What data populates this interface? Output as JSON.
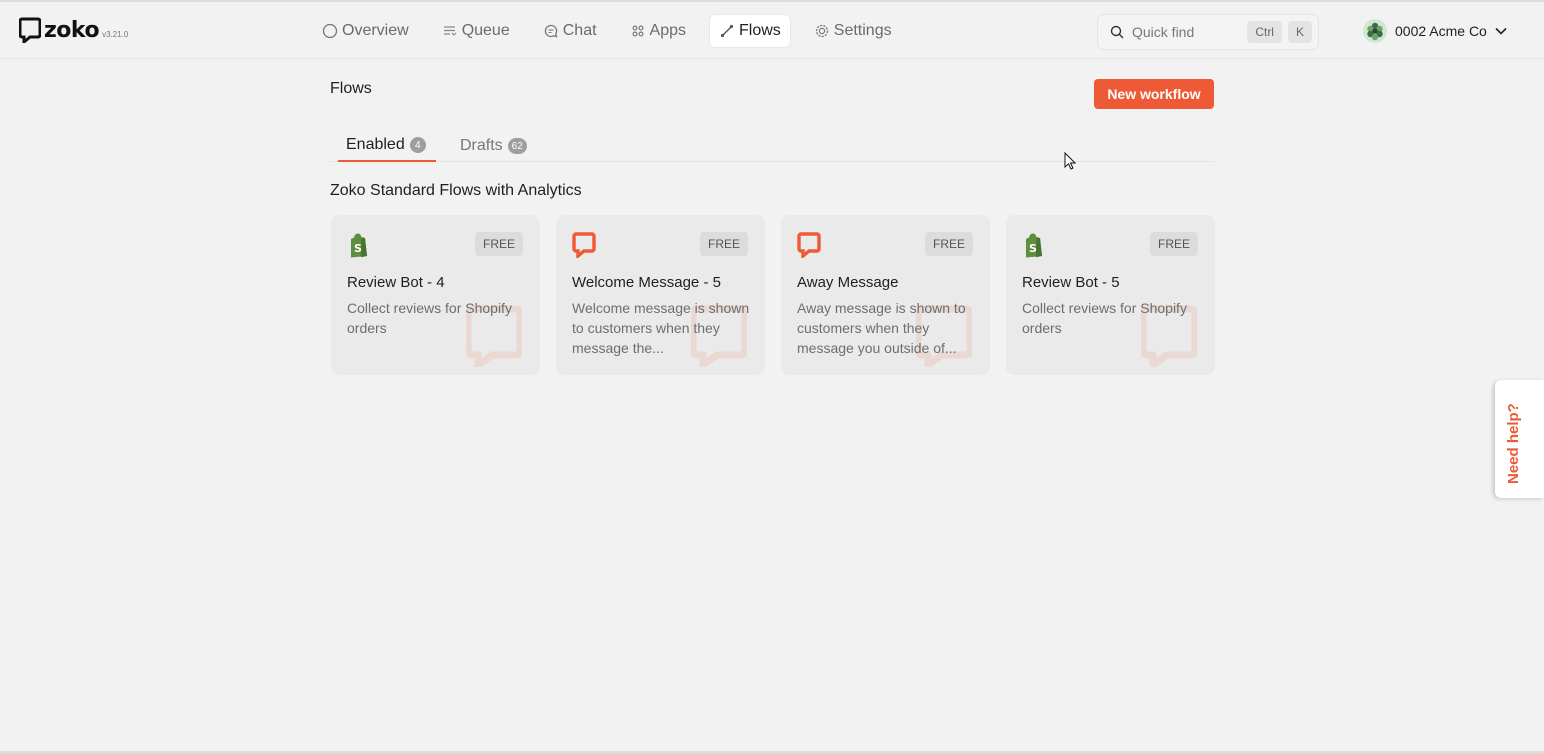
{
  "app": {
    "name": "zoko",
    "version": "v3.21.0"
  },
  "nav": [
    {
      "label": "Overview",
      "icon": "circle-icon",
      "active": false
    },
    {
      "label": "Queue",
      "icon": "queue-icon",
      "active": false
    },
    {
      "label": "Chat",
      "icon": "chat-icon",
      "active": false
    },
    {
      "label": "Apps",
      "icon": "apps-grid-icon",
      "active": false
    },
    {
      "label": "Flows",
      "icon": "flows-icon",
      "active": true
    },
    {
      "label": "Settings",
      "icon": "gear-icon",
      "active": false
    }
  ],
  "search": {
    "placeholder": "Quick find",
    "shortcut_mod": "Ctrl",
    "shortcut_key": "K"
  },
  "account": {
    "name": "0002 Acme Co"
  },
  "page": {
    "title": "Flows",
    "new_button": "New workflow"
  },
  "tabs": [
    {
      "label": "Enabled",
      "count": "4",
      "active": true
    },
    {
      "label": "Drafts",
      "count": "62",
      "active": false
    }
  ],
  "section": {
    "title": "Zoko Standard Flows with Analytics"
  },
  "cards": [
    {
      "icon": "shopify-icon",
      "badge": "FREE",
      "title": "Review Bot - 4",
      "description": "Collect reviews for Shopify orders"
    },
    {
      "icon": "zoko-icon",
      "badge": "FREE",
      "title": "Welcome Message - 5",
      "description": "Welcome message is shown to customers when they message the..."
    },
    {
      "icon": "zoko-icon",
      "badge": "FREE",
      "title": "Away Message",
      "description": "Away message is shown to customers when they message you outside of..."
    },
    {
      "icon": "shopify-icon",
      "badge": "FREE",
      "title": "Review Bot - 5",
      "description": "Collect reviews for Shopify orders"
    }
  ],
  "help": {
    "label": "Need help?"
  },
  "colors": {
    "accent": "#ee5a36",
    "shopify": "#5e8e3e",
    "background": "#f2f2f2"
  }
}
